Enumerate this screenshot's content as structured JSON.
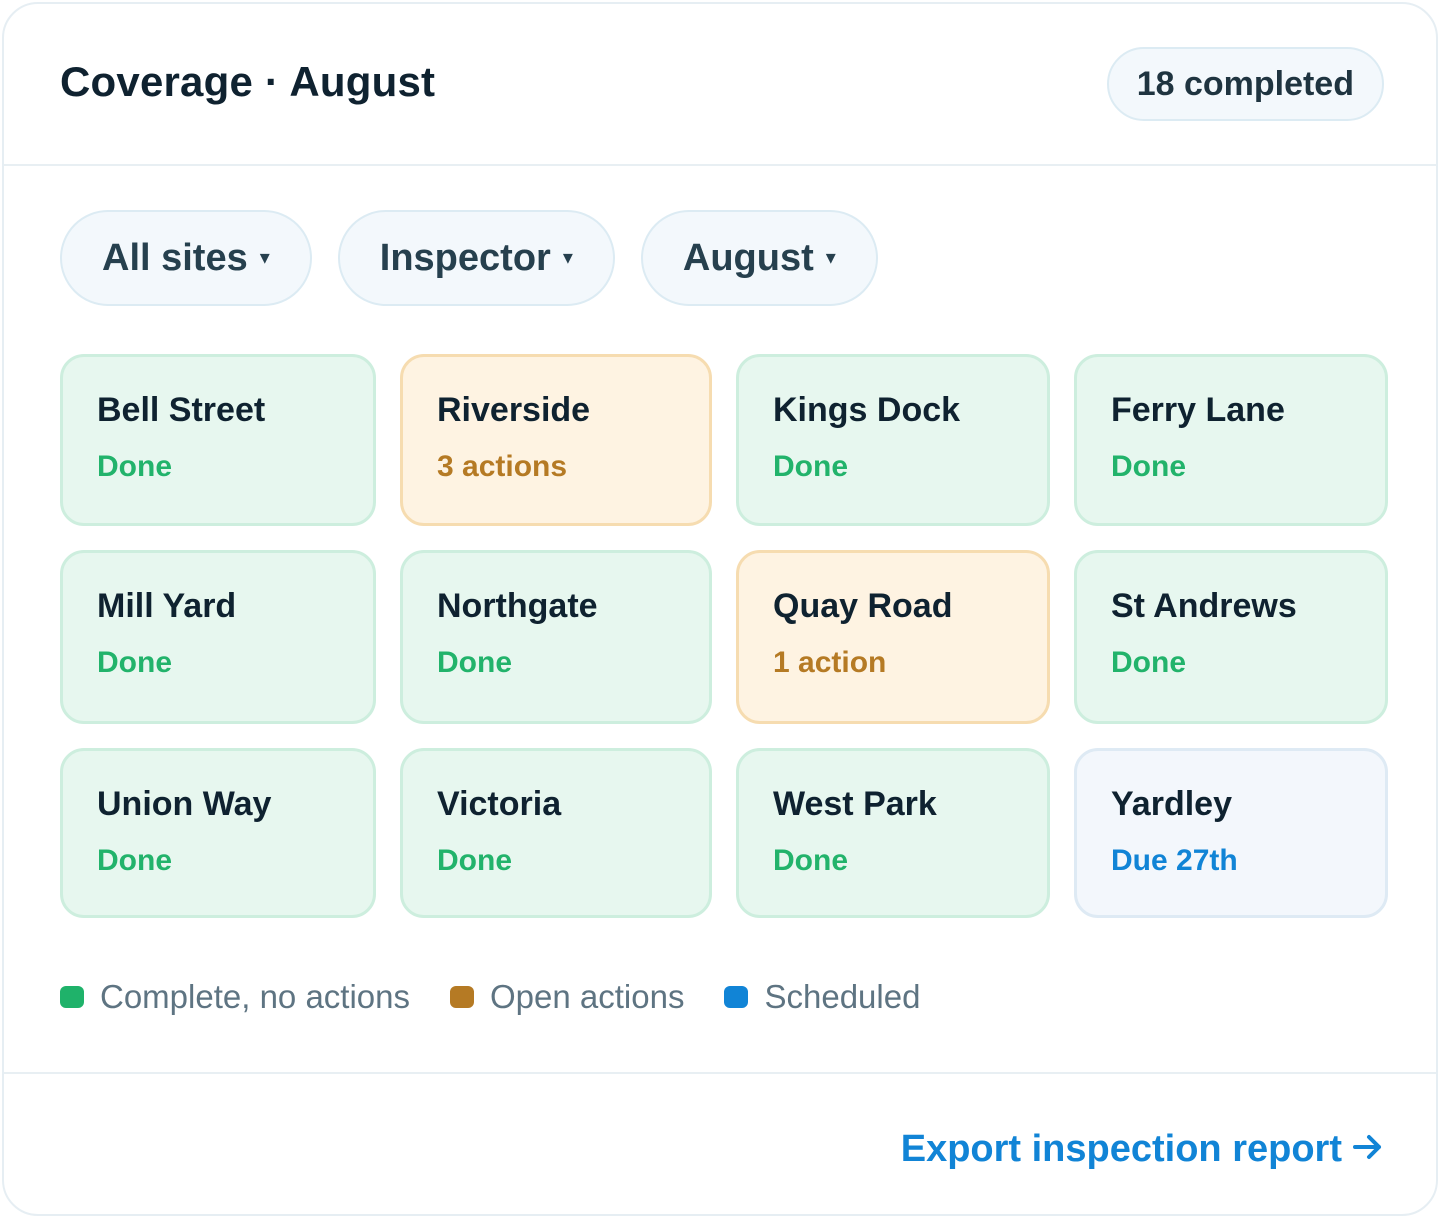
{
  "header": {
    "title": "Coverage · August",
    "badge": "18 completed"
  },
  "filters": [
    {
      "label": "All sites",
      "caret": "▾"
    },
    {
      "label": "Inspector",
      "caret": "▾"
    },
    {
      "label": "August",
      "caret": "▾"
    }
  ],
  "sites": [
    {
      "name": "Bell Street",
      "status": "Done",
      "state": "complete"
    },
    {
      "name": "Riverside",
      "status": "3 actions",
      "state": "open-actions"
    },
    {
      "name": "Kings Dock",
      "status": "Done",
      "state": "complete"
    },
    {
      "name": "Ferry Lane",
      "status": "Done",
      "state": "complete"
    },
    {
      "name": "Mill Yard",
      "status": "Done",
      "state": "complete"
    },
    {
      "name": "Northgate",
      "status": "Done",
      "state": "complete"
    },
    {
      "name": "Quay Road",
      "status": "1 action",
      "state": "open-actions"
    },
    {
      "name": "St Andrews",
      "status": "Done",
      "state": "complete"
    },
    {
      "name": "Union Way",
      "status": "Done",
      "state": "complete"
    },
    {
      "name": "Victoria",
      "status": "Done",
      "state": "complete"
    },
    {
      "name": "West Park",
      "status": "Done",
      "state": "complete"
    },
    {
      "name": "Yardley",
      "status": "Due 27th",
      "state": "scheduled"
    }
  ],
  "legend": [
    {
      "label": "Complete, no actions",
      "color": "#1fb26a"
    },
    {
      "label": "Open actions",
      "color": "#b57a24"
    },
    {
      "label": "Scheduled",
      "color": "#1184d6"
    }
  ],
  "footer": {
    "export_label": "Export inspection report",
    "export_icon": "arrow-right-icon"
  }
}
